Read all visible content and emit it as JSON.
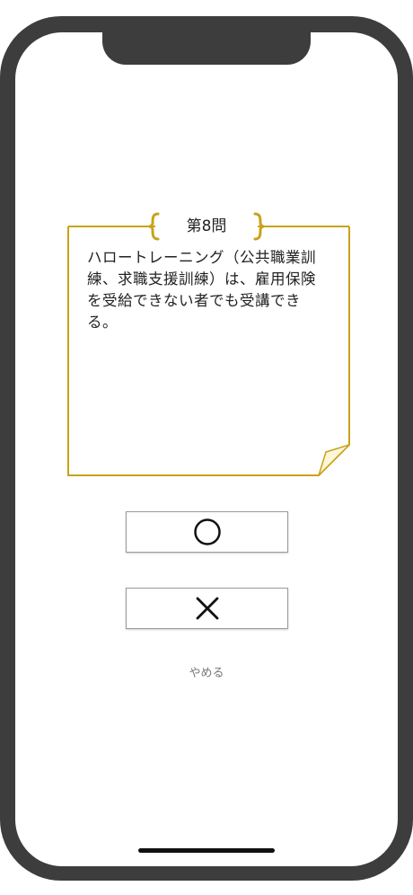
{
  "quiz": {
    "question_number": "第8問",
    "question_text": "ハロートレーニング（公共職業訓練、求職支援訓練）は、雇用保険を受給できない者でも受講できる。"
  },
  "answers": {
    "true_symbol": "◯",
    "false_symbol": "✕"
  },
  "actions": {
    "quit_label": "やめる"
  },
  "colors": {
    "note_border": "#c9a21a",
    "frame": "#3d3d3d"
  },
  "icons": {
    "true": "circle-icon",
    "false": "cross-icon"
  }
}
